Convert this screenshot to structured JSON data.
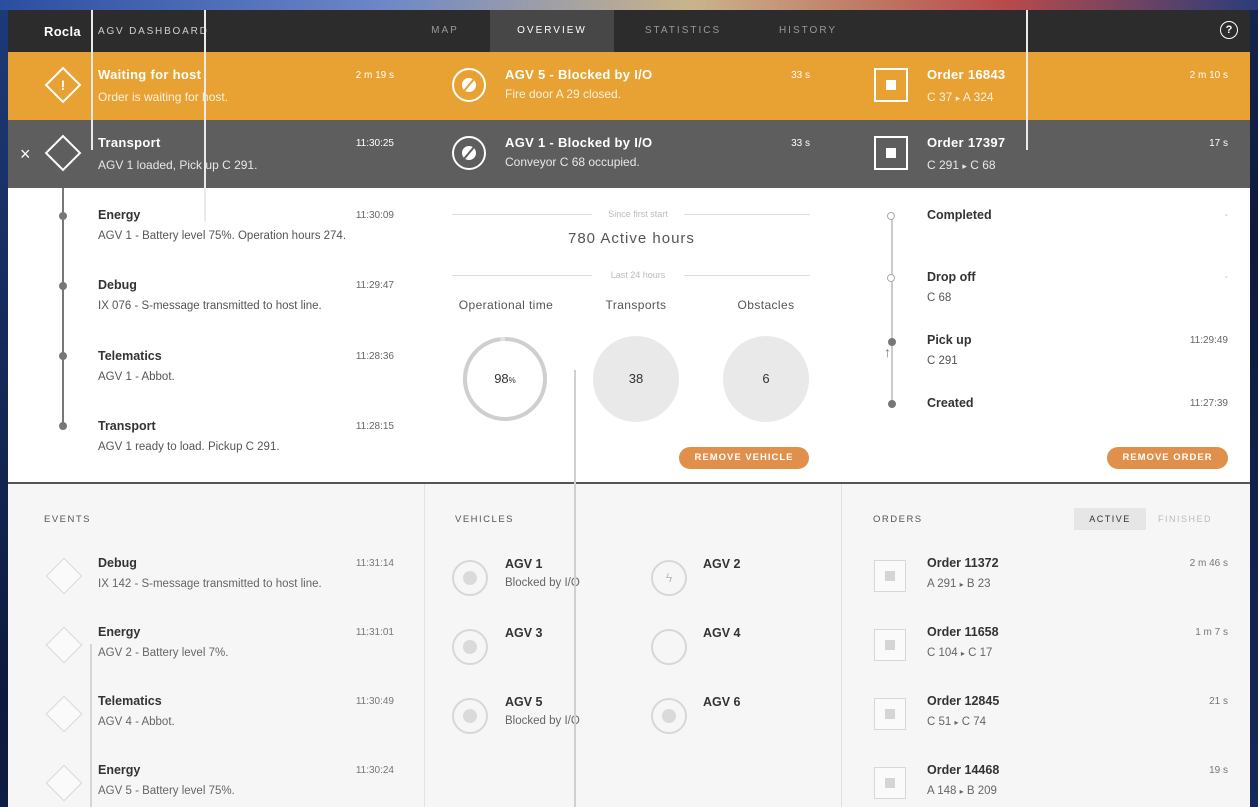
{
  "header": {
    "logo": "Rocla",
    "app_title": "AGV DASHBOARD",
    "tabs": [
      {
        "label": "MAP"
      },
      {
        "label": "OVERVIEW"
      },
      {
        "label": "STATISTICS"
      },
      {
        "label": "HISTORY"
      }
    ],
    "active_tab": "OVERVIEW",
    "help_symbol": "?"
  },
  "alerts": {
    "events": [
      {
        "title": "Waiting for host",
        "subtitle": "Order is waiting for host.",
        "time": "2 m 19 s",
        "icon": "warning-diamond-icon"
      },
      {
        "title": "Transport",
        "subtitle": "AGV 1 loaded, Pick up C 291.",
        "time": "11:30:25",
        "icon": "diamond-icon"
      }
    ],
    "vehicles": [
      {
        "title": "AGV 5 - Blocked by I/O",
        "subtitle": "Fire door A 29 closed.",
        "time": "33 s"
      },
      {
        "title": "AGV 1 - Blocked by I/O",
        "subtitle": "Conveyor C 68 occupied.",
        "time": "33 s"
      }
    ],
    "orders": [
      {
        "title": "Order 16843",
        "from": "C 37",
        "to": "A 324",
        "time": "2 m 10 s"
      },
      {
        "title": "Order 17397",
        "from": "C 291",
        "to": "C 68",
        "time": "17 s"
      }
    ],
    "route_arrow": "▸",
    "close_symbol": "×"
  },
  "event_detail": {
    "items": [
      {
        "title": "Energy",
        "subtitle": "AGV 1 - Battery level 75%. Operation hours 274.",
        "time": "11:30:09"
      },
      {
        "title": "Debug",
        "subtitle": "IX 076 - S-message transmitted to host line.",
        "time": "11:29:47"
      },
      {
        "title": "Telematics",
        "subtitle": "AGV 1 - Abbot.",
        "time": "11:28:36"
      },
      {
        "title": "Transport",
        "subtitle": "AGV 1 ready to load. Pickup C 291.",
        "time": "11:28:15"
      }
    ]
  },
  "vehicle_detail": {
    "since_label": "Since first start",
    "active_hours": "780 Active hours",
    "last24_label": "Last 24 hours",
    "stats": [
      {
        "label": "Operational time",
        "value": "98",
        "unit": "%"
      },
      {
        "label": "Transports",
        "value": "38"
      },
      {
        "label": "Obstacles",
        "value": "6"
      }
    ],
    "operational_fraction": 0.98,
    "remove_button": "REMOVE VEHICLE"
  },
  "order_detail": {
    "steps": [
      {
        "title": "Completed",
        "subtitle": "",
        "time": "-"
      },
      {
        "title": "Drop off",
        "subtitle": "C 68",
        "time": "-"
      },
      {
        "title": "Pick up",
        "subtitle": "C 291",
        "time": "11:29:49"
      },
      {
        "title": "Created",
        "subtitle": "",
        "time": "11:27:39"
      }
    ],
    "remove_button": "REMOVE ORDER"
  },
  "events": {
    "heading": "EVENTS",
    "items": [
      {
        "title": "Debug",
        "subtitle": "IX 142 - S-message transmitted to host line.",
        "time": "11:31:14"
      },
      {
        "title": "Energy",
        "subtitle": "AGV 2 - Battery level 7%.",
        "time": "11:31:01"
      },
      {
        "title": "Telematics",
        "subtitle": "AGV 4 - Abbot.",
        "time": "11:30:49"
      },
      {
        "title": "Energy",
        "subtitle": "AGV 5 - Battery level 75%.",
        "time": "11:30:24"
      }
    ]
  },
  "vehicles": {
    "heading": "VEHICLES",
    "items": [
      {
        "name": "AGV 1",
        "status": "Blocked by I/O"
      },
      {
        "name": "AGV 2",
        "status": ""
      },
      {
        "name": "AGV 3",
        "status": ""
      },
      {
        "name": "AGV 4",
        "status": ""
      },
      {
        "name": "AGV 5",
        "status": "Blocked by I/O"
      },
      {
        "name": "AGV 6",
        "status": ""
      }
    ]
  },
  "orders": {
    "heading": "ORDERS",
    "filter": {
      "active": "ACTIVE",
      "finished": "FINISHED",
      "selected": "ACTIVE"
    },
    "items": [
      {
        "title": "Order 11372",
        "from": "A 291",
        "to": "B 23",
        "time": "2 m 46 s"
      },
      {
        "title": "Order 11658",
        "from": "C 104",
        "to": "C 17",
        "time": "1 m 7 s"
      },
      {
        "title": "Order 12845",
        "from": "C 51",
        "to": "C 74",
        "time": "21 s"
      },
      {
        "title": "Order 14468",
        "from": "A 148",
        "to": "B 209",
        "time": "19 s"
      }
    ]
  },
  "colors": {
    "accent_orange": "#e8a133",
    "button_orange": "#e0904a",
    "selected_row_grey": "#5e5e5e",
    "topbar": "#2c2c2c"
  }
}
